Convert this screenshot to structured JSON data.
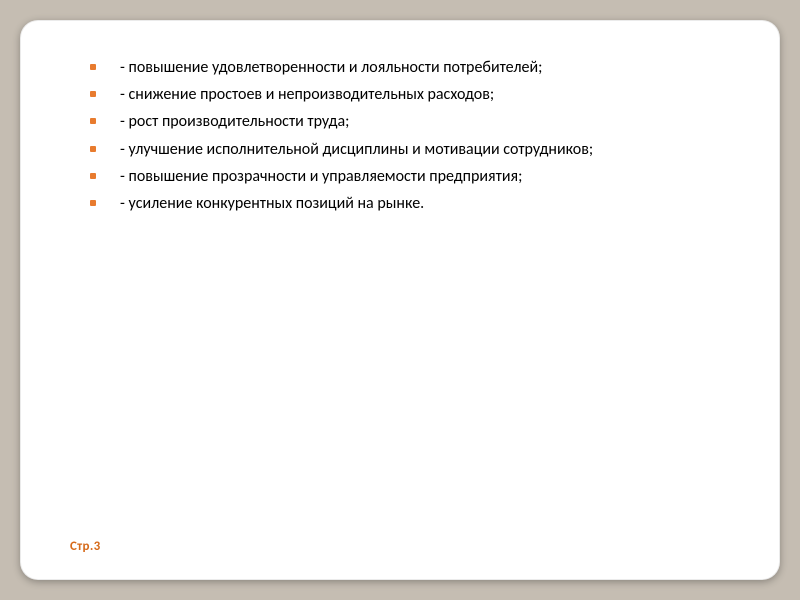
{
  "slide": {
    "bullets": [
      "- повышение удовлетворенности и лояльности потребителей;",
      "- снижение простоев и непроизводительных расходов;",
      "- рост производительности труда;",
      "- улучшение исполнительной дисциплины и мотивации сотрудников;",
      "- повышение прозрачности и управляемости предприятия;",
      "- усиление конкурентных позиций на рынке."
    ],
    "footer": "Стр.3"
  }
}
